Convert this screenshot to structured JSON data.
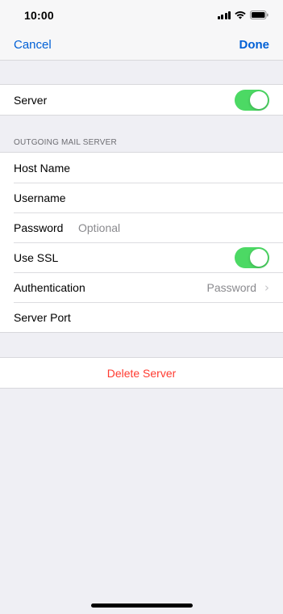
{
  "status_bar": {
    "time": "10:00",
    "icons": [
      "signal-icon",
      "wifi-icon",
      "battery-icon"
    ]
  },
  "nav": {
    "cancel_label": "Cancel",
    "done_label": "Done"
  },
  "server_group": {
    "server_label": "Server",
    "server_toggle_on": true
  },
  "outgoing": {
    "section_header": "OUTGOING MAIL SERVER",
    "host_name_label": "Host Name",
    "host_name_value": "",
    "username_label": "Username",
    "username_value": "",
    "password_label": "Password",
    "password_placeholder": "Optional",
    "use_ssl_label": "Use SSL",
    "use_ssl_on": true,
    "authentication_label": "Authentication",
    "authentication_value": "Password",
    "server_port_label": "Server Port",
    "server_port_value": ""
  },
  "delete": {
    "label": "Delete Server"
  },
  "colors": {
    "accent": "#0060d6",
    "toggle_on": "#4cd964",
    "destructive": "#ff3b30",
    "background": "#efeff4"
  }
}
